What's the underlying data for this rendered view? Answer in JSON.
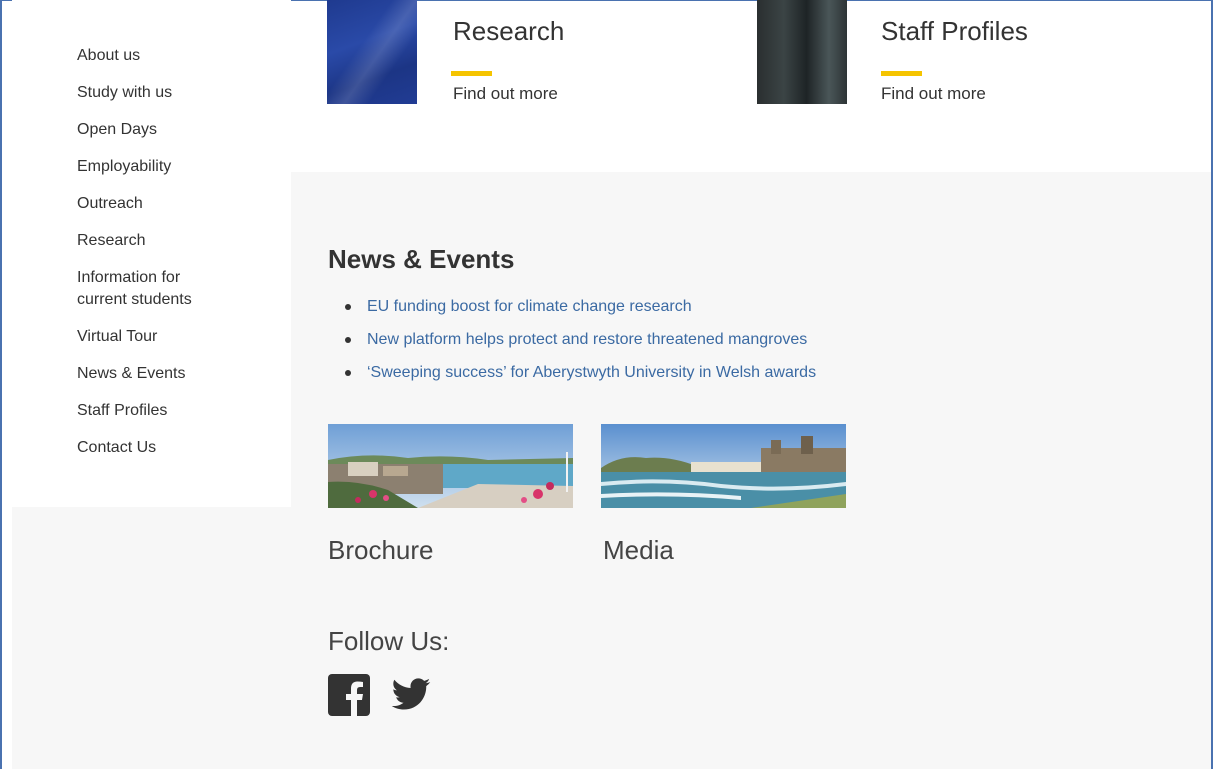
{
  "sidebar": {
    "items": [
      {
        "label": "About us"
      },
      {
        "label": "Study with us"
      },
      {
        "label": "Open Days"
      },
      {
        "label": "Employability"
      },
      {
        "label": "Outreach"
      },
      {
        "label": "Research"
      },
      {
        "label": "Information for current students"
      },
      {
        "label": "Virtual Tour"
      },
      {
        "label": "News & Events"
      },
      {
        "label": "Staff Profiles"
      },
      {
        "label": "Contact Us"
      }
    ]
  },
  "cards": {
    "research": {
      "title": "Research",
      "link": "Find out more"
    },
    "staff": {
      "title": "Staff Profiles",
      "link": "Find out more"
    }
  },
  "news": {
    "heading": "News & Events",
    "items": [
      "EU funding boost for climate change research",
      "New platform helps protect and restore threatened mangroves",
      "‘Sweeping success’ for Aberystwyth University in Welsh awards"
    ]
  },
  "tiles": {
    "brochure": "Brochure",
    "media": "Media"
  },
  "follow": {
    "heading": "Follow Us:",
    "icons": [
      "facebook-icon",
      "twitter-icon"
    ]
  },
  "colors": {
    "accent_bar": "#f5c400",
    "link": "#3b6aa3",
    "gray_bg": "#f7f7f7"
  }
}
